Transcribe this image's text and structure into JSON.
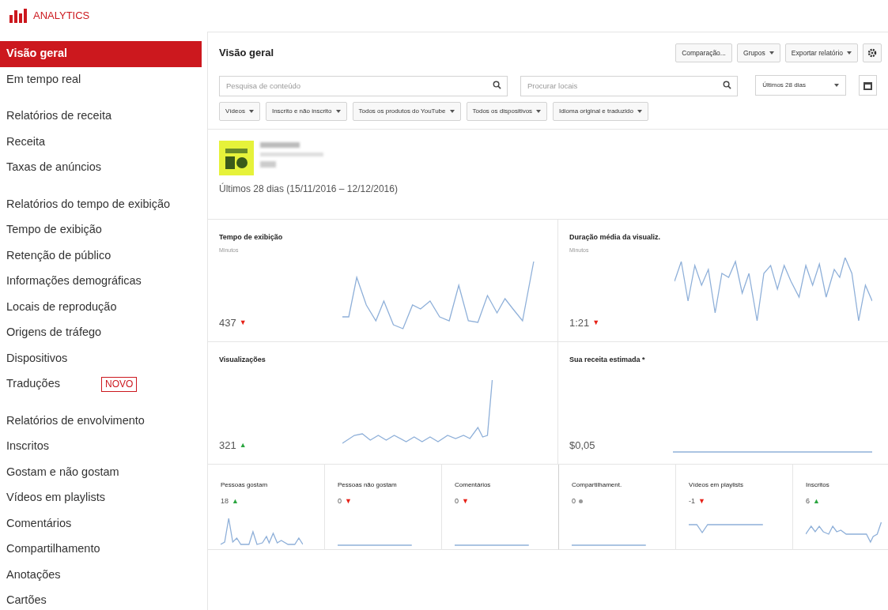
{
  "logo": {
    "text": "ANALYTICS"
  },
  "sidebar": {
    "groups": [
      {
        "items": [
          {
            "label": "Visão geral",
            "selected": true
          },
          {
            "label": "Em tempo real",
            "selected": false
          }
        ]
      },
      {
        "items": [
          {
            "label": "Relatórios de receita",
            "selected": false
          },
          {
            "label": "Receita",
            "selected": false
          },
          {
            "label": "Taxas de anúncios",
            "selected": false
          }
        ]
      },
      {
        "items": [
          {
            "label": "Relatórios do tempo de exibição",
            "selected": false
          },
          {
            "label": "Tempo de exibição",
            "selected": false
          },
          {
            "label": "Retenção de público",
            "selected": false
          },
          {
            "label": "Informações demográficas",
            "selected": false
          },
          {
            "label": "Locais de reprodução",
            "selected": false
          },
          {
            "label": "Origens de tráfego",
            "selected": false
          },
          {
            "label": "Dispositivos",
            "selected": false
          },
          {
            "label": "Traduções",
            "selected": false,
            "badge": "NOVO"
          }
        ]
      },
      {
        "items": [
          {
            "label": "Relatórios de envolvimento",
            "selected": false
          },
          {
            "label": "Inscritos",
            "selected": false
          },
          {
            "label": "Gostam e não gostam",
            "selected": false
          },
          {
            "label": "Vídeos em playlists",
            "selected": false
          },
          {
            "label": "Comentários",
            "selected": false
          },
          {
            "label": "Compartilhamento",
            "selected": false
          },
          {
            "label": "Anotações",
            "selected": false
          },
          {
            "label": "Cartões",
            "selected": false
          }
        ]
      }
    ]
  },
  "header": {
    "title": "Visão geral",
    "buttons": [
      {
        "label": "Comparação...",
        "dropdown": false
      },
      {
        "label": "Grupos",
        "dropdown": true
      },
      {
        "label": "Exportar relatório",
        "dropdown": true
      }
    ]
  },
  "search": [
    {
      "placeholder": "Pesquisa de conteúdo"
    },
    {
      "placeholder": "Procurar locais"
    }
  ],
  "date_range": {
    "value": "Últimos 28 dias"
  },
  "filters": [
    "Vídeos",
    "Inscrito e não inscrito",
    "Todos os produtos do YouTube",
    "Todos os dispositivos",
    "Idioma original e traduzido"
  ],
  "video": {
    "kind": "picture",
    "period": "Últimos 28 dias (15/11/2016 – 12/12/2016)"
  },
  "big_metrics": [
    {
      "title": "Tempo de exibição",
      "unit": "Minutos",
      "value": "437",
      "trend": {
        "kind": "down",
        "symbol": "▼"
      }
    },
    {
      "title": "Duração média da visualiz.",
      "unit": "Minutos",
      "value": "1:21",
      "trend": {
        "kind": "down",
        "symbol": "▼"
      }
    },
    {
      "title": "Visualizações",
      "value": "321",
      "trend": {
        "kind": "up",
        "symbol": "▲"
      }
    },
    {
      "title": "Sua receita estimada *",
      "value": "$0,05"
    }
  ],
  "small_metrics": [
    {
      "title": "Pessoas gostam",
      "value": "18",
      "trend": {
        "kind": "up",
        "symbol": "▲"
      }
    },
    {
      "title": "Pessoas não gostam",
      "value": "0",
      "trend": {
        "kind": "down",
        "symbol": "▼"
      }
    },
    {
      "title": "Comentários",
      "value": "0",
      "trend": {
        "kind": "down",
        "symbol": "▼"
      }
    },
    {
      "title": "Compartilhament.",
      "value": "0",
      "trend": {
        "kind": "flat"
      }
    },
    {
      "title": "Vídeos em playlists",
      "value": "-1",
      "trend": {
        "kind": "down",
        "symbol": "▼"
      }
    },
    {
      "title": "Inscritos",
      "value": "6",
      "trend": {
        "kind": "up",
        "symbol": "▲"
      }
    }
  ]
}
